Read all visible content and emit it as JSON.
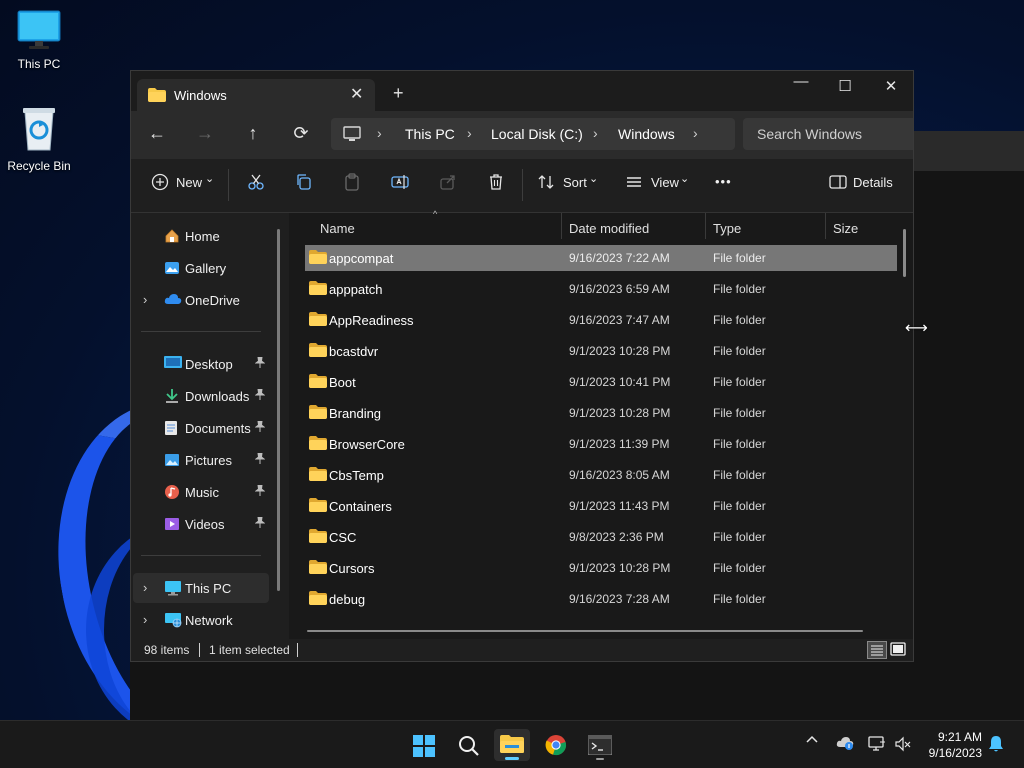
{
  "desktop": {
    "icons": [
      {
        "label": "This PC",
        "icon": "monitor-icon"
      },
      {
        "label": "Recycle Bin",
        "icon": "recycle-bin-icon"
      }
    ]
  },
  "window": {
    "tab_title": "Windows",
    "new_tab": "+",
    "close_tab": "✕",
    "controls": {
      "minimize": "—",
      "maximize": "☐",
      "close": "✕"
    }
  },
  "address": {
    "breadcrumbs": [
      "This PC",
      "Local Disk (C:)",
      "Windows"
    ],
    "separator": "›",
    "search_placeholder": "Search Windows"
  },
  "nav_buttons": {
    "back": "←",
    "forward": "→",
    "up": "↑",
    "refresh": "⟳"
  },
  "command_bar": {
    "new_label": "New",
    "sort_label": "Sort",
    "view_label": "View",
    "more_label": "•••",
    "details_label": "Details",
    "dropdown": "⌄"
  },
  "nav_pane": {
    "top": [
      {
        "label": "Home",
        "icon": "home-icon",
        "chevron": ""
      },
      {
        "label": "Gallery",
        "icon": "gallery-icon",
        "chevron": ""
      },
      {
        "label": "OneDrive",
        "icon": "onedrive-cloud-icon",
        "chevron": "›"
      }
    ],
    "quick": [
      {
        "label": "Desktop",
        "icon": "desktop-folder-icon",
        "pin": "📌"
      },
      {
        "label": "Downloads",
        "icon": "downloads-icon",
        "pin": "📌"
      },
      {
        "label": "Documents",
        "icon": "documents-icon",
        "pin": "📌"
      },
      {
        "label": "Pictures",
        "icon": "pictures-icon",
        "pin": "📌"
      },
      {
        "label": "Music",
        "icon": "music-icon",
        "pin": "📌"
      },
      {
        "label": "Videos",
        "icon": "videos-icon",
        "pin": "📌"
      }
    ],
    "bottom": [
      {
        "label": "This PC",
        "icon": "this-pc-icon",
        "chevron": "›",
        "selected": true
      },
      {
        "label": "Network",
        "icon": "network-icon",
        "chevron": "›",
        "selected": false
      }
    ]
  },
  "columns": {
    "name": "Name",
    "date": "Date modified",
    "type": "Type",
    "size": "Size"
  },
  "files": [
    {
      "name": "appcompat",
      "date": "9/16/2023 7:22 AM",
      "type": "File folder",
      "selected": true
    },
    {
      "name": "apppatch",
      "date": "9/16/2023 6:59 AM",
      "type": "File folder"
    },
    {
      "name": "AppReadiness",
      "date": "9/16/2023 7:47 AM",
      "type": "File folder"
    },
    {
      "name": "bcastdvr",
      "date": "9/1/2023 10:28 PM",
      "type": "File folder"
    },
    {
      "name": "Boot",
      "date": "9/1/2023 10:41 PM",
      "type": "File folder"
    },
    {
      "name": "Branding",
      "date": "9/1/2023 10:28 PM",
      "type": "File folder"
    },
    {
      "name": "BrowserCore",
      "date": "9/1/2023 11:39 PM",
      "type": "File folder"
    },
    {
      "name": "CbsTemp",
      "date": "9/16/2023 8:05 AM",
      "type": "File folder"
    },
    {
      "name": "Containers",
      "date": "9/1/2023 11:43 PM",
      "type": "File folder"
    },
    {
      "name": "CSC",
      "date": "9/8/2023 2:36 PM",
      "type": "File folder"
    },
    {
      "name": "Cursors",
      "date": "9/1/2023 10:28 PM",
      "type": "File folder"
    },
    {
      "name": "debug",
      "date": "9/16/2023 7:28 AM",
      "type": "File folder"
    }
  ],
  "status": {
    "items": "98 items",
    "selection": "1 item selected"
  },
  "taskbar": {
    "apps": [
      {
        "name": "start-button",
        "icon": "windows-logo-icon"
      },
      {
        "name": "search-button",
        "icon": "search-icon"
      },
      {
        "name": "file-explorer-app",
        "icon": "file-explorer-icon",
        "active": true
      },
      {
        "name": "chrome-app",
        "icon": "chrome-icon"
      },
      {
        "name": "terminal-app",
        "icon": "terminal-icon"
      }
    ],
    "time": "9:21 AM",
    "date": "9/16/2023"
  },
  "colors": {
    "accent": "#60cdff",
    "folder": "#f7c948",
    "selection": "#777777"
  }
}
